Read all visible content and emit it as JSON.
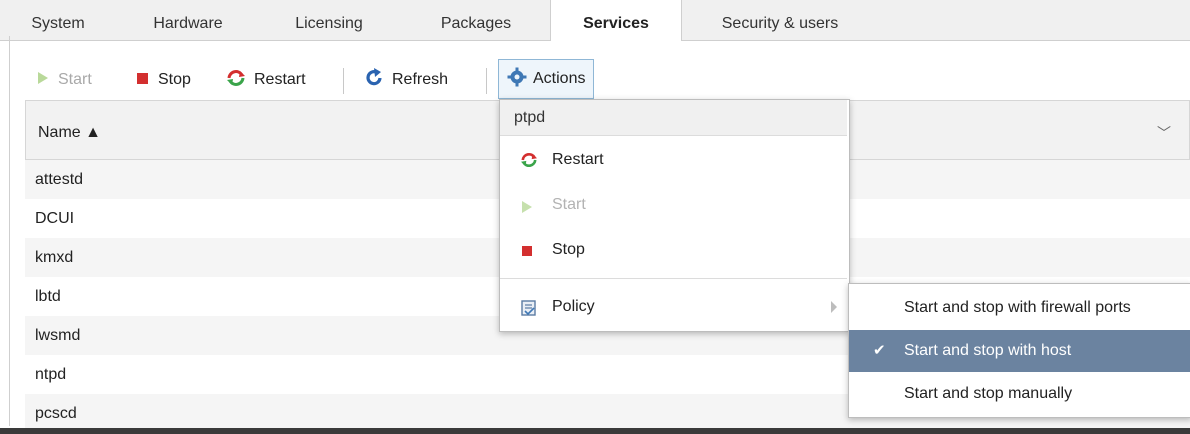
{
  "tabs": [
    "System",
    "Hardware",
    "Licensing",
    "Packages",
    "Services",
    "Security & users"
  ],
  "active_tab": "Services",
  "toolbar": {
    "start": "Start",
    "stop": "Stop",
    "restart": "Restart",
    "refresh": "Refresh",
    "actions": "Actions"
  },
  "grid": {
    "name_header": "Name ▲",
    "rows": [
      "attestd",
      "DCUI",
      "kmxd",
      "lbtd",
      "lwsmd",
      "ntpd",
      "pcscd"
    ]
  },
  "actions_menu": {
    "title": "ptpd",
    "items": {
      "restart": "Restart",
      "start": "Start",
      "stop": "Stop",
      "policy": "Policy"
    }
  },
  "policy_submenu": {
    "items": [
      "Start and stop with firewall ports",
      "Start and stop with host",
      "Start and stop manually"
    ],
    "selected": "Start and stop with host",
    "check": "✔"
  },
  "colors": {
    "selected_bg": "#6b83a0",
    "stop_red": "#d32f2f",
    "start_green": "#7bc043",
    "refresh_blue": "#2a63b0"
  }
}
